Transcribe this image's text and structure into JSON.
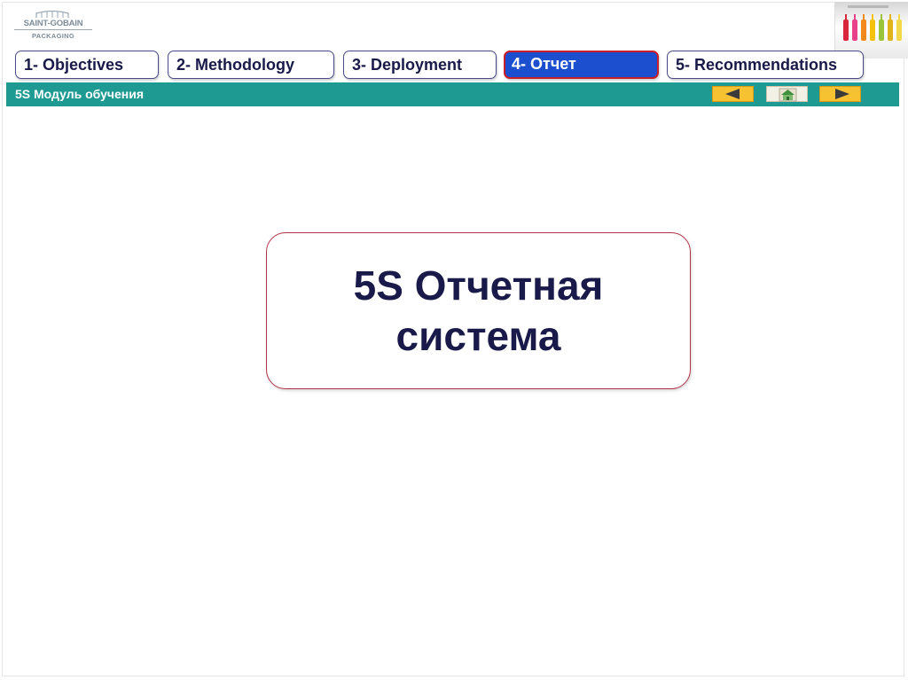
{
  "logo": {
    "name": "SAINT-GOBAIN",
    "subtitle": "PACKAGING"
  },
  "tabs": [
    {
      "label": "1- Objectives",
      "active": false
    },
    {
      "label": "2- Methodology",
      "active": false
    },
    {
      "label": "3- Deployment",
      "active": false
    },
    {
      "label": "4- Отчет",
      "active": true
    },
    {
      "label": "5- Recommendations",
      "active": false
    }
  ],
  "module_bar": {
    "title": "5S Модуль обучения"
  },
  "nav": {
    "prev": "back-arrow-icon",
    "home": "home-icon",
    "next": "forward-arrow-icon"
  },
  "card": {
    "title": "5S Отчетная система"
  },
  "colors": {
    "tab_text": "#1a1a4a",
    "active_tab_bg": "#1c4fd0",
    "active_tab_border": "#c8202a",
    "bar_bg": "#1f9a93",
    "nav_button": "#f7c232",
    "card_border": "#b2334a"
  }
}
